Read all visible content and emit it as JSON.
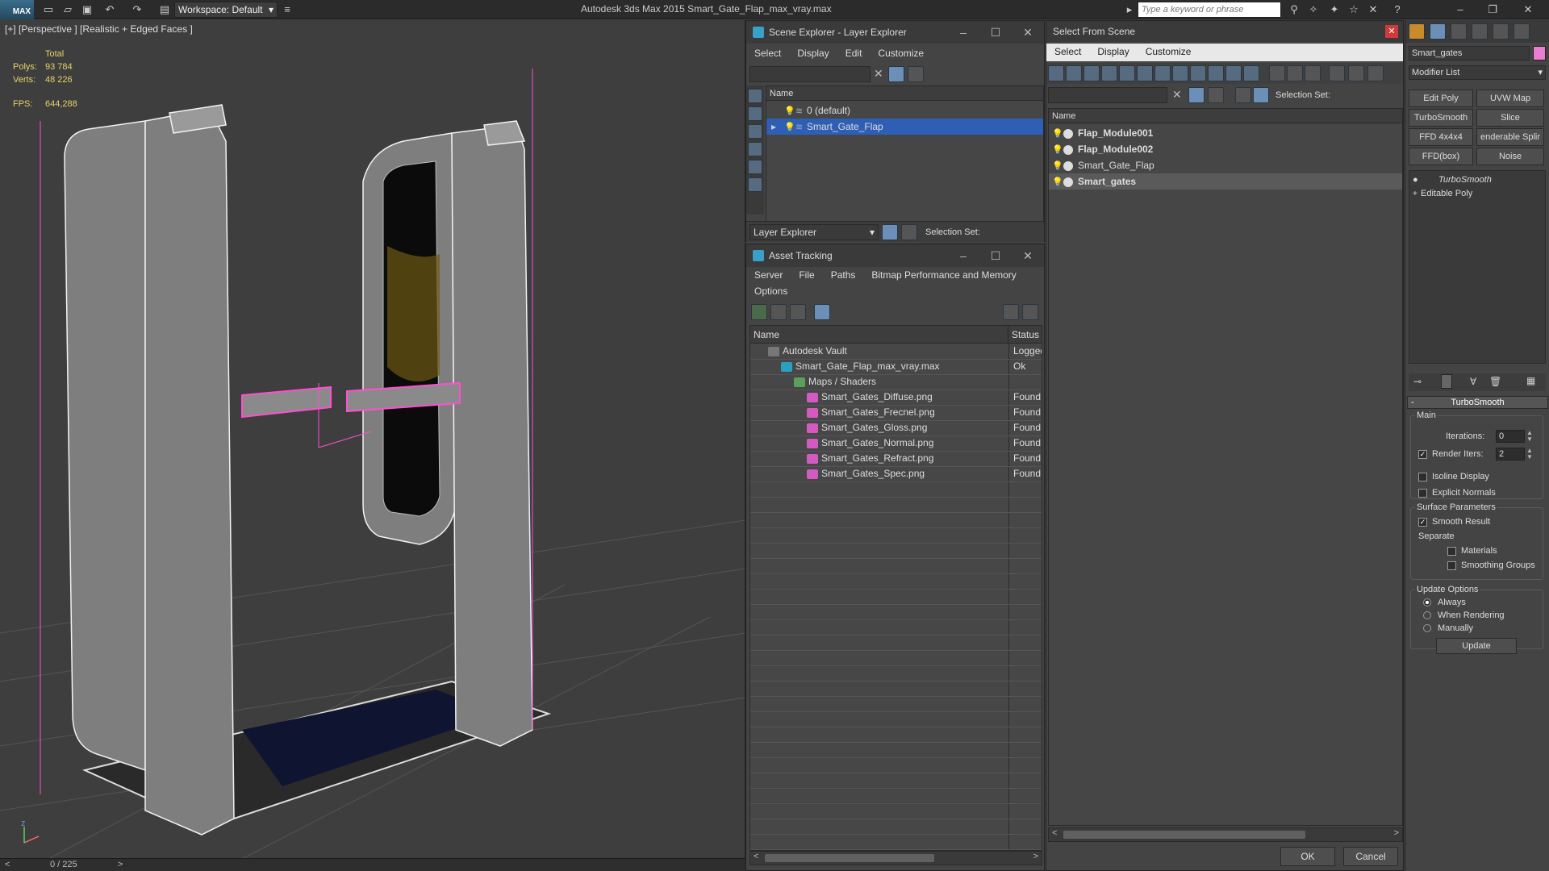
{
  "app": {
    "logo": "MAX",
    "workspace": "Workspace: Default",
    "title": "Autodesk 3ds Max  2015     Smart_Gate_Flap_max_vray.max",
    "search_placeholder": "Type a keyword or phrase"
  },
  "viewport": {
    "label": "[+] [Perspective ] [Realistic + Edged Faces ]",
    "stats": {
      "total_label": "Total",
      "polys_label": "Polys:",
      "polys_value": "93 784",
      "verts_label": "Verts:",
      "verts_value": "48 226",
      "fps_label": "FPS:",
      "fps_value": "644,288"
    },
    "axis_z": "z",
    "timeline": "0 / 225"
  },
  "scene_explorer": {
    "title": "Scene Explorer - Layer Explorer",
    "menu": [
      "Select",
      "Display",
      "Edit",
      "Customize"
    ],
    "column": "Name",
    "layers": [
      "0 (default)",
      "Smart_Gate_Flap"
    ],
    "footer_label": "Layer Explorer",
    "selection_set": "Selection Set:"
  },
  "asset_tracking": {
    "title": "Asset Tracking",
    "menu": [
      "Server",
      "File",
      "Paths",
      "Bitmap Performance and Memory"
    ],
    "menu2": [
      "Options"
    ],
    "columns": [
      "Name",
      "Status"
    ],
    "rows": [
      {
        "name": "Autodesk Vault",
        "status": "Logged",
        "indent": 0,
        "icon": "vault-icon"
      },
      {
        "name": "Smart_Gate_Flap_max_vray.max",
        "status": "Ok",
        "indent": 1,
        "icon": "max-file-icon"
      },
      {
        "name": "Maps / Shaders",
        "status": "",
        "indent": 2,
        "icon": "maps-icon"
      },
      {
        "name": "Smart_Gates_Diffuse.png",
        "status": "Found",
        "indent": 3,
        "icon": "png-icon"
      },
      {
        "name": "Smart_Gates_Frecnel.png",
        "status": "Found",
        "indent": 3,
        "icon": "png-icon"
      },
      {
        "name": "Smart_Gates_Gloss.png",
        "status": "Found",
        "indent": 3,
        "icon": "png-icon"
      },
      {
        "name": "Smart_Gates_Normal.png",
        "status": "Found",
        "indent": 3,
        "icon": "png-icon"
      },
      {
        "name": "Smart_Gates_Refract.png",
        "status": "Found",
        "indent": 3,
        "icon": "png-icon"
      },
      {
        "name": "Smart_Gates_Spec.png",
        "status": "Found",
        "indent": 3,
        "icon": "png-icon"
      }
    ]
  },
  "select_from_scene": {
    "title": "Select From Scene",
    "menu": [
      "Select",
      "Display",
      "Customize"
    ],
    "selection_set": "Selection Set:",
    "column": "Name",
    "objects": [
      {
        "name": "Flap_Module001",
        "bold": true
      },
      {
        "name": "Flap_Module002",
        "bold": true
      },
      {
        "name": "Smart_Gate_Flap",
        "bold": false
      },
      {
        "name": "Smart_gates",
        "bold": true,
        "selected": true
      }
    ],
    "ok": "OK",
    "cancel": "Cancel"
  },
  "command_panel": {
    "object_name": "Smart_gates",
    "modifier_list": "Modifier List",
    "buttons": [
      "Edit Poly",
      "UVW Map",
      "TurboSmooth",
      "Slice",
      "FFD 4x4x4",
      "enderable Splir",
      "FFD(box)",
      "Noise"
    ],
    "stack": [
      "TurboSmooth",
      "Editable Poly"
    ],
    "rollout_title": "TurboSmooth",
    "main_label": "Main",
    "iterations_label": "Iterations:",
    "iterations_value": "0",
    "render_iters_label": "Render Iters:",
    "render_iters_value": "2",
    "isoline_label": "Isoline Display",
    "explicit_label": "Explicit Normals",
    "surface_label": "Surface Parameters",
    "smooth_label": "Smooth Result",
    "separate_label": "Separate",
    "materials_label": "Materials",
    "smoothing_label": "Smoothing Groups",
    "update_options_label": "Update Options",
    "always_label": "Always",
    "when_rendering_label": "When Rendering",
    "manually_label": "Manually",
    "update_button": "Update",
    "color_swatch": "#e87fd2"
  }
}
